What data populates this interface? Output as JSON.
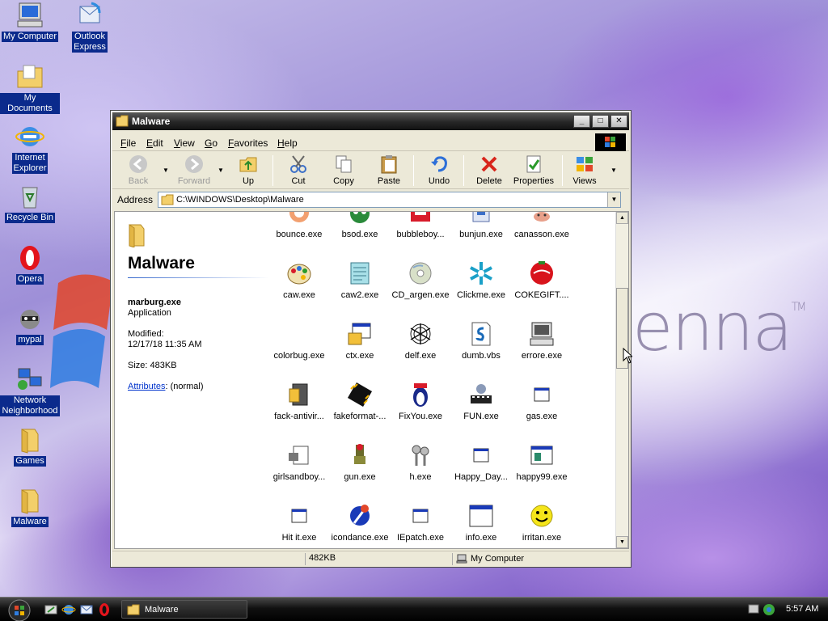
{
  "desktop": {
    "wallpaper_text": "enna",
    "wallpaper_mark": "TM",
    "icons": [
      {
        "label": "My Computer",
        "icon": "my-computer-icon"
      },
      {
        "label": "Outlook Express",
        "label_line2": "Express",
        "label_line1": "Outlook",
        "icon": "outlook-express-icon"
      },
      {
        "label": "My Documents",
        "icon": "my-documents-icon"
      },
      {
        "label_line1": "Internet",
        "label_line2": "Explorer",
        "icon": "internet-explorer-icon"
      },
      {
        "label": "Recycle Bin",
        "icon": "recycle-bin-icon"
      },
      {
        "label": "Opera",
        "icon": "opera-icon"
      },
      {
        "label": "mypal",
        "icon": "mypal-icon"
      },
      {
        "label_line1": "Network",
        "label_line2": "Neighborhood",
        "icon": "network-neighborhood-icon"
      },
      {
        "label": "Games",
        "icon": "folder-icon"
      },
      {
        "label": "Malware",
        "icon": "folder-icon"
      }
    ]
  },
  "window": {
    "title": "Malware",
    "controls": {
      "minimize": "_",
      "maximize": "□",
      "close": "✕"
    },
    "menu": [
      "File",
      "Edit",
      "View",
      "Go",
      "Favorites",
      "Help"
    ],
    "toolbar": {
      "back": "Back",
      "forward": "Forward",
      "up": "Up",
      "cut": "Cut",
      "copy": "Copy",
      "paste": "Paste",
      "undo": "Undo",
      "delete": "Delete",
      "properties": "Properties",
      "views": "Views"
    },
    "address": {
      "label": "Address",
      "path": "C:\\WINDOWS\\Desktop\\Malware"
    },
    "info_pane": {
      "title": "Malware",
      "selected_name": "marburg.exe",
      "selected_type": "Application",
      "modified_label": "Modified:",
      "modified_value": "12/17/18 11:35 AM",
      "size": "Size: 483KB",
      "attributes_link": "Attributes",
      "attributes_value": ": (normal)"
    },
    "files": [
      {
        "name": "bounce.exe",
        "icon": "bounce-icon"
      },
      {
        "name": "bsod.exe",
        "icon": "bsod-icon"
      },
      {
        "name": "bubbleboy...",
        "icon": "bubbleboy-icon"
      },
      {
        "name": "bunjun.exe",
        "icon": "bunjun-icon"
      },
      {
        "name": "canasson.exe",
        "icon": "canasson-icon"
      },
      {
        "name": "caw.exe",
        "icon": "paint-palette-icon"
      },
      {
        "name": "caw2.exe",
        "icon": "notepad-icon"
      },
      {
        "name": "CD_argen.exe",
        "icon": "cd-icon"
      },
      {
        "name": "Clickme.exe",
        "icon": "snowflake-icon"
      },
      {
        "name": "COKEGIFT....",
        "icon": "coke-icon"
      },
      {
        "name": "colorbug.exe",
        "icon": "blank-icon"
      },
      {
        "name": "ctx.exe",
        "icon": "window-app-icon"
      },
      {
        "name": "delf.exe",
        "icon": "web-icon"
      },
      {
        "name": "dumb.vbs",
        "icon": "script-icon"
      },
      {
        "name": "errore.exe",
        "icon": "computer-icon"
      },
      {
        "name": "fack-antivir...",
        "icon": "photo-app-icon"
      },
      {
        "name": "fakeformat-...",
        "icon": "chip-icon"
      },
      {
        "name": "FixYou.exe",
        "icon": "penguin-icon"
      },
      {
        "name": "FUN.exe",
        "icon": "film-app-icon"
      },
      {
        "name": "gas.exe",
        "icon": "generic-exe-icon"
      },
      {
        "name": "girlsandboy...",
        "icon": "setup-icon"
      },
      {
        "name": "gun.exe",
        "icon": "gun-icon"
      },
      {
        "name": "h.exe",
        "icon": "keys-icon"
      },
      {
        "name": "Happy_Day...",
        "icon": "generic-exe-icon"
      },
      {
        "name": "happy99.exe",
        "icon": "card-icon"
      },
      {
        "name": "Hit it.exe",
        "icon": "generic-exe-icon"
      },
      {
        "name": "icondance.exe",
        "icon": "torch-icon"
      },
      {
        "name": "IEpatch.exe",
        "icon": "generic-exe-icon"
      },
      {
        "name": "info.exe",
        "icon": "window-app-icon"
      },
      {
        "name": "irritan.exe",
        "icon": "smiley-icon"
      }
    ],
    "status": {
      "size": "482KB",
      "zone": "My Computer"
    }
  },
  "taskbar": {
    "task_button": "Malware",
    "clock": "5:57 AM"
  },
  "colors": {
    "selection_blue": "#0b2a8c",
    "link_blue": "#0033cc",
    "titlebar": "#262626"
  }
}
